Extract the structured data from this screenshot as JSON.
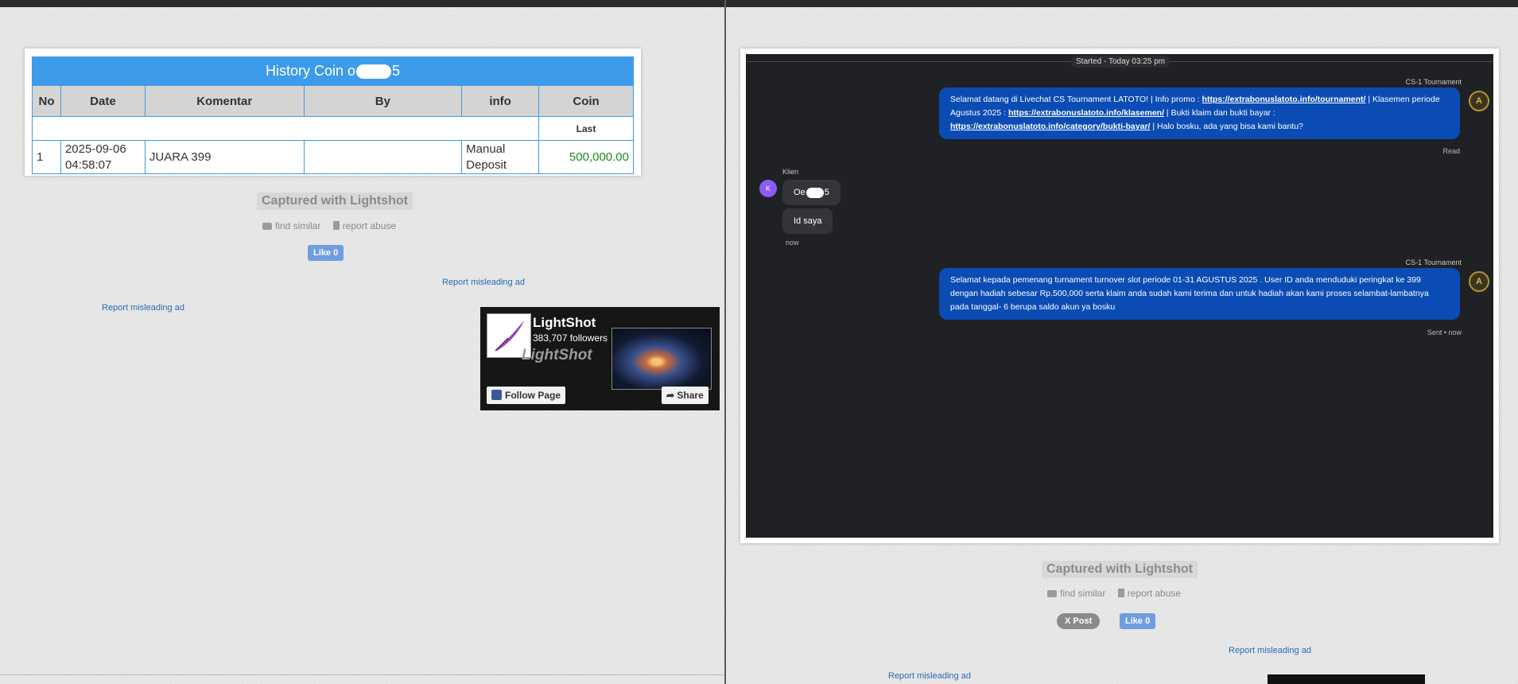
{
  "left": {
    "history": {
      "title_prefix": "History Coin o",
      "title_suffix": "5",
      "columns": [
        "No",
        "Date",
        "Komentar",
        "By",
        "info",
        "Coin"
      ],
      "sub_label": "Last",
      "rows": [
        {
          "no": "1",
          "date_line1": "2025-09-06",
          "date_line2": "04:58:07",
          "komentar": "JUARA 399",
          "by": "",
          "info_line1": "Manual",
          "info_line2": "Deposit",
          "coin": "500,000.00"
        }
      ]
    },
    "captured_label": "Captured with Lightshot",
    "find_similar": "find similar",
    "report_abuse": "report abuse",
    "like_label": "Like 0",
    "report_misleading_1": "Report misleading ad",
    "report_misleading_2": "Report misleading ad",
    "widget": {
      "name": "LightShot",
      "followers": "383,707 followers",
      "brand_text": "LightShot",
      "follow_label": "Follow Page",
      "share_label": "Share"
    }
  },
  "right": {
    "chat": {
      "started": "Started - Today 03:25 pm",
      "agent_name_1": "CS-1 Tournament",
      "msg1_part1": "Selamat datang di Livechat CS Tournament LATOTO! | Info promo : ",
      "msg1_link1": "https://extrabonuslatoto.info/tournament/",
      "msg1_part2": " | Klasemen periode Agustus 2025 : ",
      "msg1_link2": "https://extrabonuslatoto.info/klasemen/",
      "msg1_part3": " | Bukti klaim dan bukti bayar : ",
      "msg1_link3": "https://extrabonuslatoto.info/category/bukti-bayar/",
      "msg1_part4": " | Halo bosku, ada yang bisa kami bantu?",
      "msg1_status": "Read",
      "client_name": "Klien",
      "client_initial": "K",
      "client_msg1_prefix": "Oe",
      "client_msg1_suffix": "5",
      "client_msg2": "Id saya",
      "client_time": "now",
      "agent_name_2": "CS-1 Tournament",
      "msg2": "Selamat kepada pemenang turnament turnover slot periode 01-31 AGUSTUS 2025 . User ID anda menduduki peringkat ke 399 dengan hadiah sebesar Rp.500,000 serta klaim anda sudah kami terima dan untuk hadiah akan kami proses selambat-lambatnya pada tanggal- 6 berupa saldo akun ya bosku",
      "msg2_status": "Sent • now",
      "agent_avatar_letter": "A"
    },
    "captured_label": "Captured with Lightshot",
    "find_similar": "find similar",
    "report_abuse": "report abuse",
    "post_label": "X Post",
    "like_label": "Like 0",
    "report_misleading_1": "Report misleading ad",
    "report_misleading_2": "Report misleading ad"
  }
}
